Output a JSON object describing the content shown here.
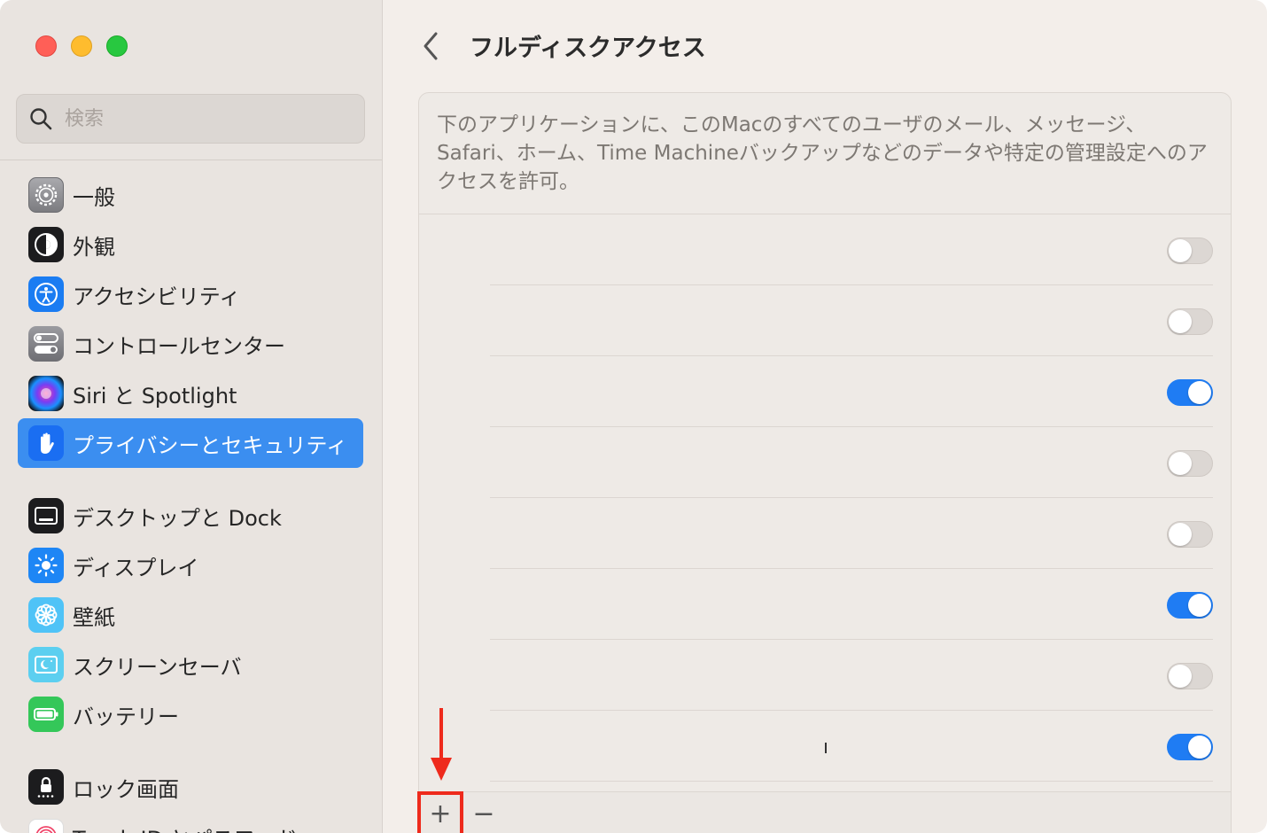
{
  "colors": {
    "accent": "#3b8ef0",
    "toggle_on": "#1f7cf3",
    "annotation_red": "#ee2a1c"
  },
  "search": {
    "placeholder": "検索"
  },
  "sidebar": {
    "items": [
      {
        "label": "一般",
        "icon": "gear-icon"
      },
      {
        "label": "外観",
        "icon": "appearance-icon"
      },
      {
        "label": "アクセシビリティ",
        "icon": "accessibility-icon"
      },
      {
        "label": "コントロールセンター",
        "icon": "control-center-icon"
      },
      {
        "label": "Siri と Spotlight",
        "icon": "siri-icon"
      },
      {
        "label": "プライバシーとセキュリティ",
        "icon": "hand-icon",
        "selected": true
      },
      {
        "label": "デスクトップと Dock",
        "icon": "dock-icon"
      },
      {
        "label": "ディスプレイ",
        "icon": "display-icon"
      },
      {
        "label": "壁紙",
        "icon": "wallpaper-icon"
      },
      {
        "label": "スクリーンセーバ",
        "icon": "screensaver-icon"
      },
      {
        "label": "バッテリー",
        "icon": "battery-icon"
      },
      {
        "label": "ロック画面",
        "icon": "lock-icon"
      },
      {
        "label": "Touch ID とパスワード",
        "icon": "fingerprint-icon"
      }
    ]
  },
  "main": {
    "title": "フルディスクアクセス",
    "description": "下のアプリケーションに、このMacのすべてのユーザのメール、メッセージ、Safari、ホーム、Time Machineバックアップなどのデータや特定の管理設定へのアクセスを許可。",
    "toggles": [
      false,
      false,
      true,
      false,
      false,
      true,
      false,
      true
    ],
    "add_label": "+",
    "remove_label": "−"
  }
}
